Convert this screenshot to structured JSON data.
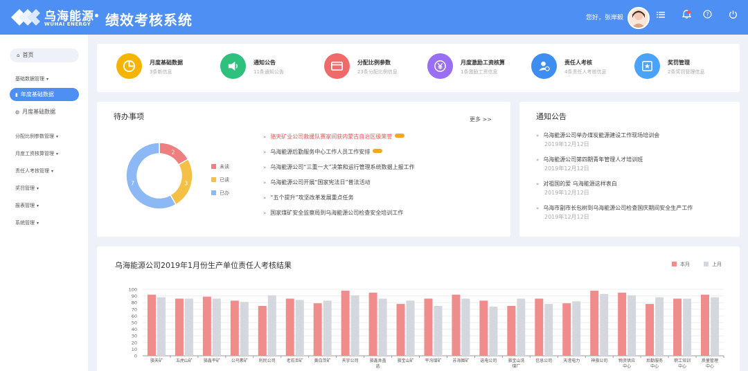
{
  "header": {
    "logo_cn": "乌海能源",
    "logo_en": "WUHAI ENERGY",
    "system_title": "绩效考核系统",
    "greeting": "您好，张岸毅"
  },
  "sidebar": {
    "home": "首页",
    "group_basic": "基础数据管理",
    "items": [
      {
        "label": "年度基础数据",
        "active": true
      },
      {
        "label": "月度基础数据",
        "active": false
      }
    ],
    "groups": [
      "分配比例参数管理",
      "月度工资核算管理",
      "责任人考核管理",
      "奖罚管理",
      "报表管理",
      "系统管理"
    ]
  },
  "quick_links": [
    {
      "title": "月度基础数据",
      "sub": "3条新信息",
      "color": "#f5b400",
      "icon": "pie-chart-icon"
    },
    {
      "title": "通知公告",
      "sub": "11条通知公告",
      "color": "#2ec17e",
      "icon": "megaphone-icon"
    },
    {
      "title": "分配比例参数",
      "sub": "23条分配比例信息",
      "color": "#ef6b6b",
      "icon": "card-icon"
    },
    {
      "title": "月度激励工资核算",
      "sub": "1条激励工资信息",
      "color": "#9a6ef2",
      "icon": "yen-icon"
    },
    {
      "title": "责任人考核",
      "sub": "4条责任人考核信息",
      "color": "#3d8ef0",
      "icon": "user-check-icon"
    },
    {
      "title": "奖罚管理",
      "sub": "2条奖罚管理信息",
      "color": "#4aa3f7",
      "icon": "award-icon"
    }
  ],
  "todo": {
    "title": "待办事项",
    "more": "更多 >>",
    "donut": [
      {
        "label": "未读",
        "value": 2,
        "color": "#ef7e7e"
      },
      {
        "label": "已读",
        "value": 3,
        "color": "#f5c046"
      },
      {
        "label": "已办",
        "value": 7,
        "color": "#8cb8f5"
      }
    ],
    "items": [
      {
        "text": "骆天矿业公司救援队赛家间获内蒙古自治区级荣誉",
        "hot": true,
        "tag": true
      },
      {
        "text": "乌海能源后勤服务中心工作人员工作安排",
        "hot": false,
        "tag": true
      },
      {
        "text": "乌海能源公司“三重一大”决策和运行管理系统数据上报工作",
        "hot": false,
        "tag": false
      },
      {
        "text": "乌海能源公司开展“国家宪法日”普法活动",
        "hot": false,
        "tag": false
      },
      {
        "text": "“五个提升”攻坚改革发展重点任务",
        "hot": false,
        "tag": false
      },
      {
        "text": "国家煤矿安全监察局到乌海能源公司检查安全培训工作",
        "hot": false,
        "tag": false
      }
    ]
  },
  "notices": {
    "title": "通知公告",
    "items": [
      {
        "text": "乌海能源公司举办煤炭能源建设工作现场培训会",
        "date": "2019年12月12日"
      },
      {
        "text": "乌海能源公司第四期青年管理人才培训班",
        "date": "2019年12月12日"
      },
      {
        "text": "对祖国的爱 乌海能源这样表白",
        "date": "2019年12月12日"
      },
      {
        "text": "乌海市副市长包树到乌海能源公司检查国庆期间安全生产工作",
        "date": "2019年12月12日"
      }
    ]
  },
  "chart_data": {
    "type": "bar",
    "title": "乌海能源公司2019年1月份生产单位责任人考核结果",
    "ylim": [
      0,
      100
    ],
    "yticks": [
      0,
      10,
      20,
      30,
      40,
      50,
      60,
      70,
      80,
      90,
      100
    ],
    "categories": [
      "骆天矿",
      "五虎山矿",
      "骆鑫平矿",
      "公乌素矿",
      "利民公司",
      "老石旦矿",
      "黄白茨矿",
      "天宇公司",
      "骆鑫井盖选",
      "骆宝山矿",
      "平沟煤矿",
      "苏海图矿",
      "选电公司",
      "骆宝山洗煤厂",
      "信息公司",
      "天滢电力",
      "神骆公司",
      "物资供应中心",
      "后勤服务中心",
      "职工培训中心",
      "质量管理中心"
    ],
    "series": [
      {
        "name": "本月",
        "color": "#f08c8c",
        "values": [
          92,
          86,
          89,
          83,
          75,
          86,
          79,
          98,
          95,
          78,
          86,
          92,
          83,
          75,
          86,
          79,
          98,
          95,
          78,
          86,
          92
        ]
      },
      {
        "name": "上月",
        "color": "#d5d7df",
        "values": [
          88,
          86,
          86,
          81,
          91,
          84,
          83,
          91,
          86,
          83,
          75,
          86,
          74,
          86,
          78,
          82,
          93,
          91,
          88,
          86,
          88
        ]
      }
    ],
    "legend_position": "top-right",
    "grid": true
  }
}
